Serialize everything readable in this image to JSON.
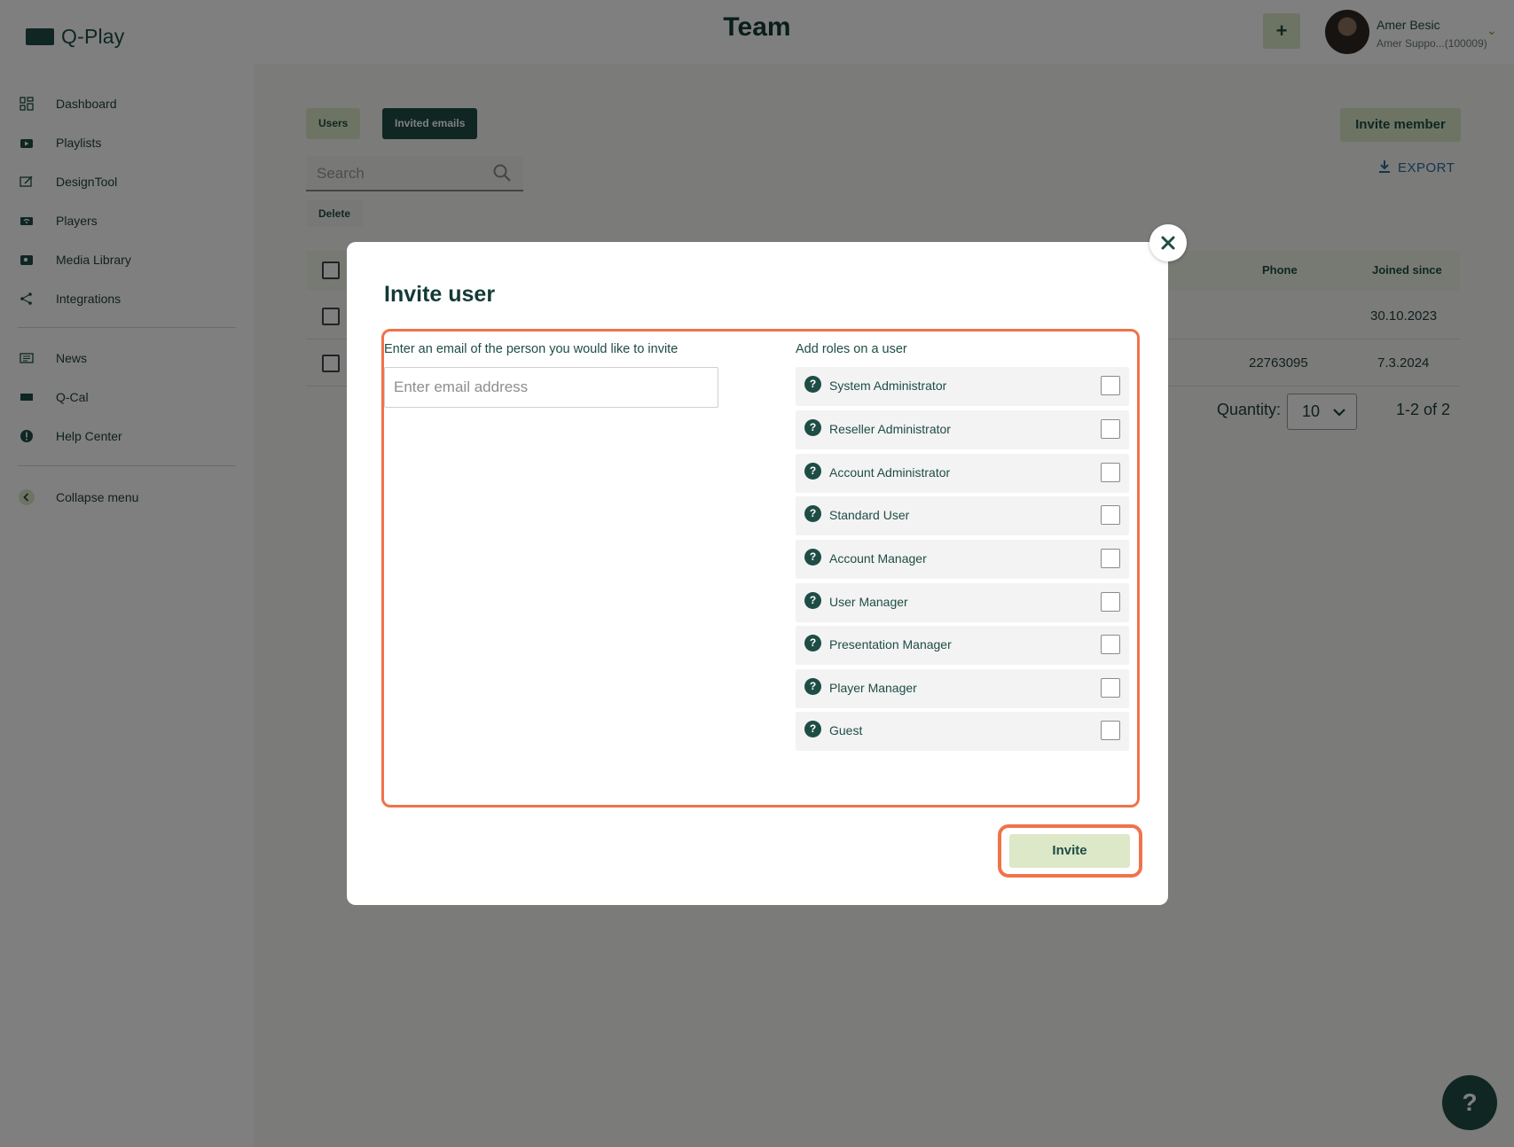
{
  "app": {
    "logo_text": "Q-Play",
    "page_title": "Team",
    "add_button_label": "+",
    "user": {
      "name": "Amer Besic",
      "account": "Amer Suppo...(100009)"
    }
  },
  "sidebar": {
    "items": [
      {
        "label": "Dashboard",
        "icon": "dashboard-icon"
      },
      {
        "label": "Playlists",
        "icon": "playlists-icon"
      },
      {
        "label": "DesignTool",
        "icon": "designtool-icon"
      },
      {
        "label": "Players",
        "icon": "players-icon"
      },
      {
        "label": "Media Library",
        "icon": "media-library-icon"
      },
      {
        "label": "Integrations",
        "icon": "integrations-icon"
      }
    ],
    "secondary_items": [
      {
        "label": "News",
        "icon": "news-icon"
      },
      {
        "label": "Q-Cal",
        "icon": "qcal-icon"
      },
      {
        "label": "Help Center",
        "icon": "help-center-icon"
      }
    ],
    "collapse_label": "Collapse menu"
  },
  "toolbar": {
    "tabs": [
      {
        "label": "Users"
      },
      {
        "label": "Invited emails"
      }
    ],
    "invite_member_label": "Invite member",
    "search_placeholder": "Search",
    "export_label": "EXPORT",
    "delete_label": "Delete"
  },
  "table": {
    "columns": [
      "Phone",
      "Joined since"
    ],
    "rows": [
      {
        "phone": "",
        "joined": "30.10.2023"
      },
      {
        "phone": "22763095",
        "joined": "7.3.2024"
      }
    ],
    "quantity_label": "Quantity:",
    "quantity_value": "10",
    "pagination": "1-2 of 2"
  },
  "modal": {
    "title": "Invite user",
    "email_label": "Enter an email of the person you would like to invite",
    "email_placeholder": "Enter email address",
    "roles_label": "Add roles on a user",
    "roles": [
      {
        "name": "System Administrator",
        "checked": false
      },
      {
        "name": "Reseller Administrator",
        "checked": false
      },
      {
        "name": "Account Administrator",
        "checked": false
      },
      {
        "name": "Standard User",
        "checked": false
      },
      {
        "name": "Account Manager",
        "checked": false
      },
      {
        "name": "User Manager",
        "checked": false
      },
      {
        "name": "Presentation Manager",
        "checked": false
      },
      {
        "name": "Player Manager",
        "checked": false
      },
      {
        "name": "Guest",
        "checked": false
      }
    ],
    "invite_label": "Invite"
  },
  "help_fab_label": "?",
  "colors": {
    "primary": "#1e4d45",
    "accent_light": "#dce8c8",
    "highlight": "#f0734a",
    "link": "#2a6b9c"
  }
}
